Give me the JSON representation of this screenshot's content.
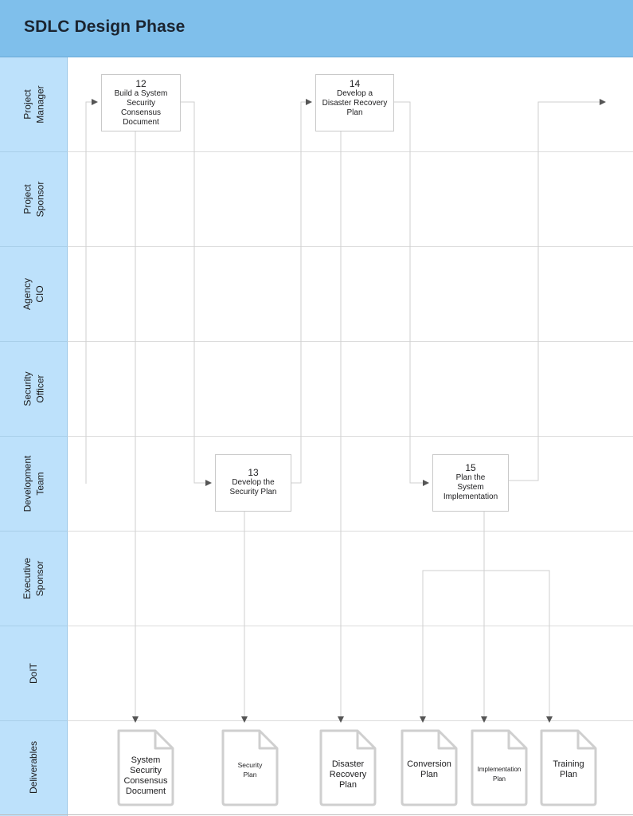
{
  "header": {
    "title": "SDLC Design Phase"
  },
  "colors": {
    "header": "#7fbfeb",
    "sidebar": "#bde1fb",
    "grid": "#dcdcdc",
    "doc_outline": "#cfcfcf",
    "arrow": "#555555"
  },
  "lanes": [
    {
      "label": "Project\nManager"
    },
    {
      "label": "Project\nSponsor"
    },
    {
      "label": "Agency\nCIO"
    },
    {
      "label": "Security\nOfficer"
    },
    {
      "label": "Development\nTeam"
    },
    {
      "label": "Executive\nSponsor"
    },
    {
      "label": "DoIT"
    },
    {
      "label": "Deliverables"
    }
  ],
  "steps": [
    {
      "number": "12",
      "label": "Build a System\nSecurity\nConsensus\nDocument",
      "lane": "Project Manager"
    },
    {
      "number": "13",
      "label": "Develop the\nSecurity Plan",
      "lane": "Development Team"
    },
    {
      "number": "14",
      "label": "Develop a\nDisaster Recovery\nPlan",
      "lane": "Project Manager"
    },
    {
      "number": "15",
      "label": "Plan the\nSystem\nImplementation",
      "lane": "Development Team"
    }
  ],
  "deliverables": [
    {
      "label": "System\nSecurity\nConsensus\nDocument",
      "icon": "document-icon"
    },
    {
      "label": "Security\nPlan",
      "icon": "document-icon"
    },
    {
      "label": "Disaster\nRecovery\nPlan",
      "icon": "document-icon"
    },
    {
      "label": "Conversion\nPlan",
      "icon": "document-icon"
    },
    {
      "label": "Implementation\nPlan",
      "icon": "document-icon"
    },
    {
      "label": "Training\nPlan",
      "icon": "document-icon"
    }
  ]
}
